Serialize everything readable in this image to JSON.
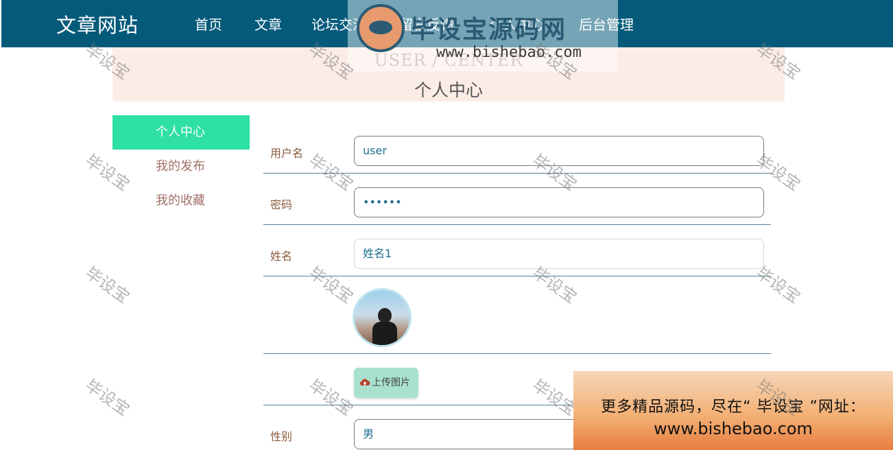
{
  "nav": {
    "brand": "文章网站",
    "items": [
      "首页",
      "文章",
      "论坛交流",
      "留言反馈",
      "个人中心",
      "后台管理"
    ]
  },
  "banner": {
    "en": "USER / CENTER",
    "cn": "个人中心"
  },
  "sidebar": {
    "items": [
      {
        "label": "个人中心",
        "active": true
      },
      {
        "label": "我的发布",
        "active": false
      },
      {
        "label": "我的收藏",
        "active": false
      }
    ]
  },
  "form": {
    "username_label": "用户名",
    "username_value": "user",
    "password_label": "密码",
    "password_value": "••••••",
    "name_label": "姓名",
    "name_value": "姓名1",
    "upload_label": "上传图片",
    "gender_label": "性别",
    "gender_value": "男"
  },
  "watermark": {
    "title": "毕设宝源码网",
    "url": "www.bishebao.com",
    "stamp": "毕设宝"
  },
  "promo": {
    "line1": "更多精品源码，尽在“ 毕设宝 ”网址：",
    "line2": "www.bishebao.com"
  },
  "colors": {
    "topbar": "#055a7a",
    "accent": "#2ee0a5",
    "banner": "#fbede6"
  }
}
